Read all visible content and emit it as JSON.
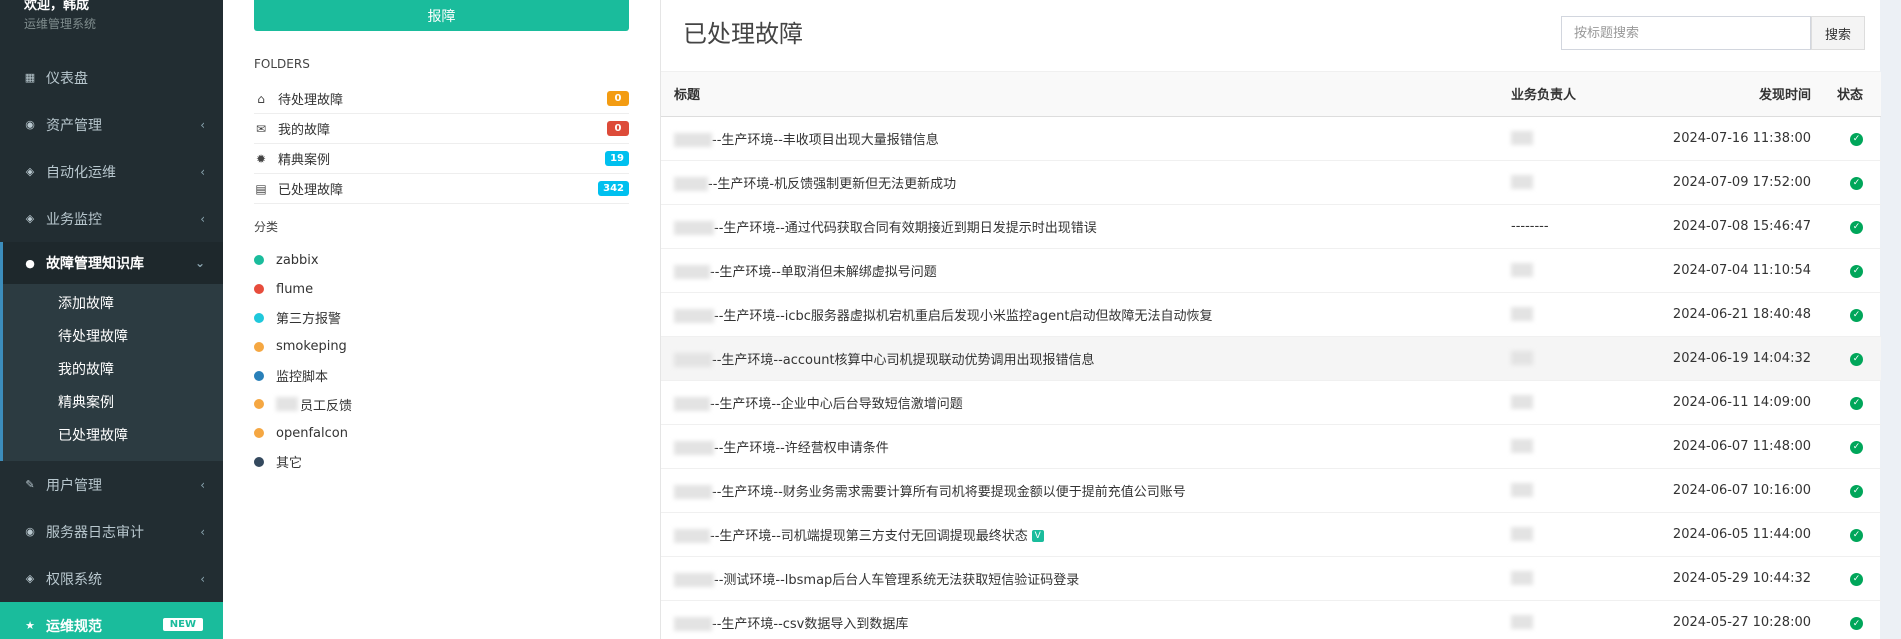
{
  "sidebar": {
    "greeting": "欢迎，韩成",
    "subtitle": "运维管理系统",
    "menu": [
      {
        "label": "仪表盘"
      },
      {
        "label": "资产管理"
      },
      {
        "label": "自动化运维"
      },
      {
        "label": "业务监控"
      },
      {
        "label": "故障管理知识库"
      },
      {
        "label": "用户管理"
      },
      {
        "label": "服务器日志审计"
      },
      {
        "label": "权限系统"
      },
      {
        "label": "运维规范",
        "badge": "NEW"
      }
    ],
    "submenu": [
      {
        "label": "添加故障"
      },
      {
        "label": "待处理故障"
      },
      {
        "label": "我的故障"
      },
      {
        "label": "精典案例"
      },
      {
        "label": "已处理故障"
      }
    ]
  },
  "folders_panel": {
    "report_button": "报障",
    "folders_title": "FOLDERS",
    "folders": [
      {
        "label": "待处理故障",
        "count": "0",
        "color": "#f39c12",
        "icon": "inbox-icon"
      },
      {
        "label": "我的故障",
        "count": "0",
        "color": "#dd4b39",
        "icon": "envelope-icon"
      },
      {
        "label": "精典案例",
        "count": "19",
        "color": "#00c0ef",
        "icon": "gear-icon"
      },
      {
        "label": "已处理故障",
        "count": "342",
        "color": "#00c0ef",
        "icon": "file-icon"
      }
    ],
    "categories_title": "分类",
    "categories": [
      {
        "label": "zabbix",
        "color": "#1abc9c"
      },
      {
        "label": "flume",
        "color": "#e74c3c"
      },
      {
        "label": "第三方报警",
        "color": "#1fc8db"
      },
      {
        "label": "smokeping",
        "color": "#f5a742"
      },
      {
        "label": "监控脚本",
        "color": "#2980b9"
      },
      {
        "label": "员工反馈",
        "color": "#f5a742"
      },
      {
        "label": "openfalcon",
        "color": "#f5a742"
      },
      {
        "label": "其它",
        "color": "#34495e"
      }
    ]
  },
  "main": {
    "title": "已处理故障",
    "search": {
      "placeholder": "按标题搜索",
      "button": "搜索"
    },
    "columns": {
      "title": "标题",
      "owner": "业务负责人",
      "time": "发现时间",
      "status": "状态"
    },
    "rows": [
      {
        "title": "--生产环境--丰收项目出现大量报错信息",
        "owner": "",
        "time": "2024-07-16 11:38:00"
      },
      {
        "title": "--生产环境-机反馈强制更新但无法更新成功",
        "owner": "",
        "time": "2024-07-09 17:52:00"
      },
      {
        "title": "--生产环境--通过代码获取合同有效期接近到期日发提示时出现错误",
        "owner": "--------",
        "time": "2024-07-08 15:46:47"
      },
      {
        "title": "--生产环境--单取消但未解绑虚拟号问题",
        "owner": "",
        "time": "2024-07-04 11:10:54"
      },
      {
        "title": "--生产环境--icbc服务器虚拟机宕机重启后发现小米监控agent启动但故障无法自动恢复",
        "owner": "",
        "time": "2024-06-21 18:40:48"
      },
      {
        "title": "--生产环境--account核算中心司机提现联动优势调用出现报错信息",
        "owner": "",
        "time": "2024-06-19 14:04:32"
      },
      {
        "title": "--生产环境--企业中心后台导致短信激增问题",
        "owner": "",
        "time": "2024-06-11 14:09:00"
      },
      {
        "title": "--生产环境--许经营权申请条件",
        "owner": "",
        "time": "2024-06-07 11:48:00"
      },
      {
        "title": "--生产环境--财务业务需求需要计算所有司机将要提现金额以便于提前充值公司账号",
        "owner": "",
        "time": "2024-06-07 10:16:00"
      },
      {
        "title": "--生产环境--司机端提现第三方支付无回调提现最终状态",
        "owner": "",
        "time": "2024-06-05 11:44:00",
        "flag": "V"
      },
      {
        "title": "--测试环境--lbsmap后台人车管理系统无法获取短信验证码登录",
        "owner": "",
        "time": "2024-05-29 10:44:32"
      },
      {
        "title": "--生产环境--csv数据导入到数据库",
        "owner": "",
        "time": "2024-05-27 10:28:00"
      }
    ]
  }
}
